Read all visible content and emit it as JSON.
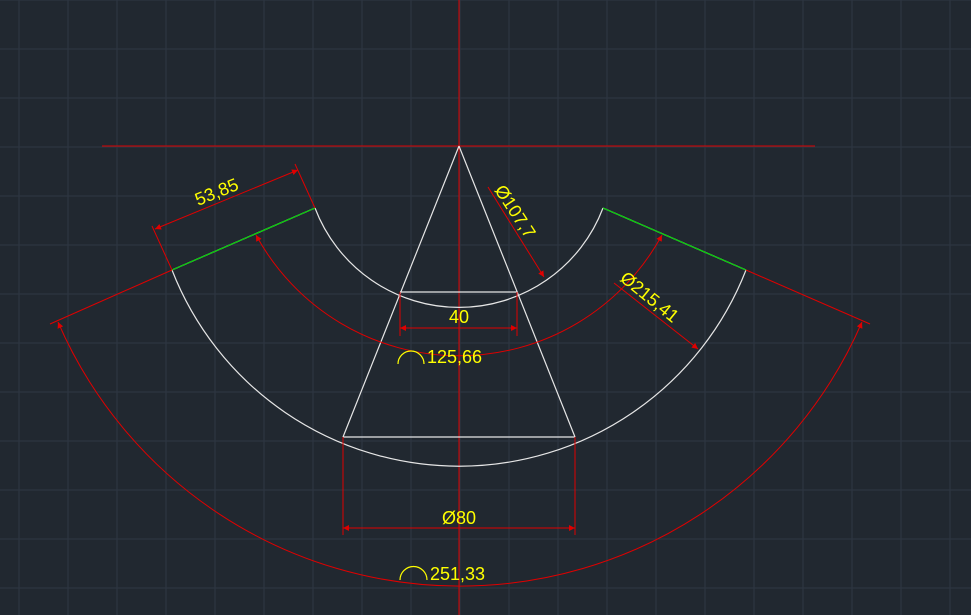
{
  "colors": {
    "background": "#212830",
    "grid": "#2e3743",
    "geometry": "#e6e6e6",
    "dimension": "#e00000",
    "extension_green": "#00d000",
    "text": "#ffff00"
  },
  "dimensions": {
    "radial_width": "53,85",
    "inner_diameter": "Ø107,7",
    "outer_diameter": "Ø215,41",
    "top_width": "40",
    "inner_arc_length": "125,66",
    "bottom_diameter": "Ø80",
    "outer_arc_length": "251,33"
  },
  "icons": {
    "arc_length_symbol": "arc-length-icon"
  }
}
